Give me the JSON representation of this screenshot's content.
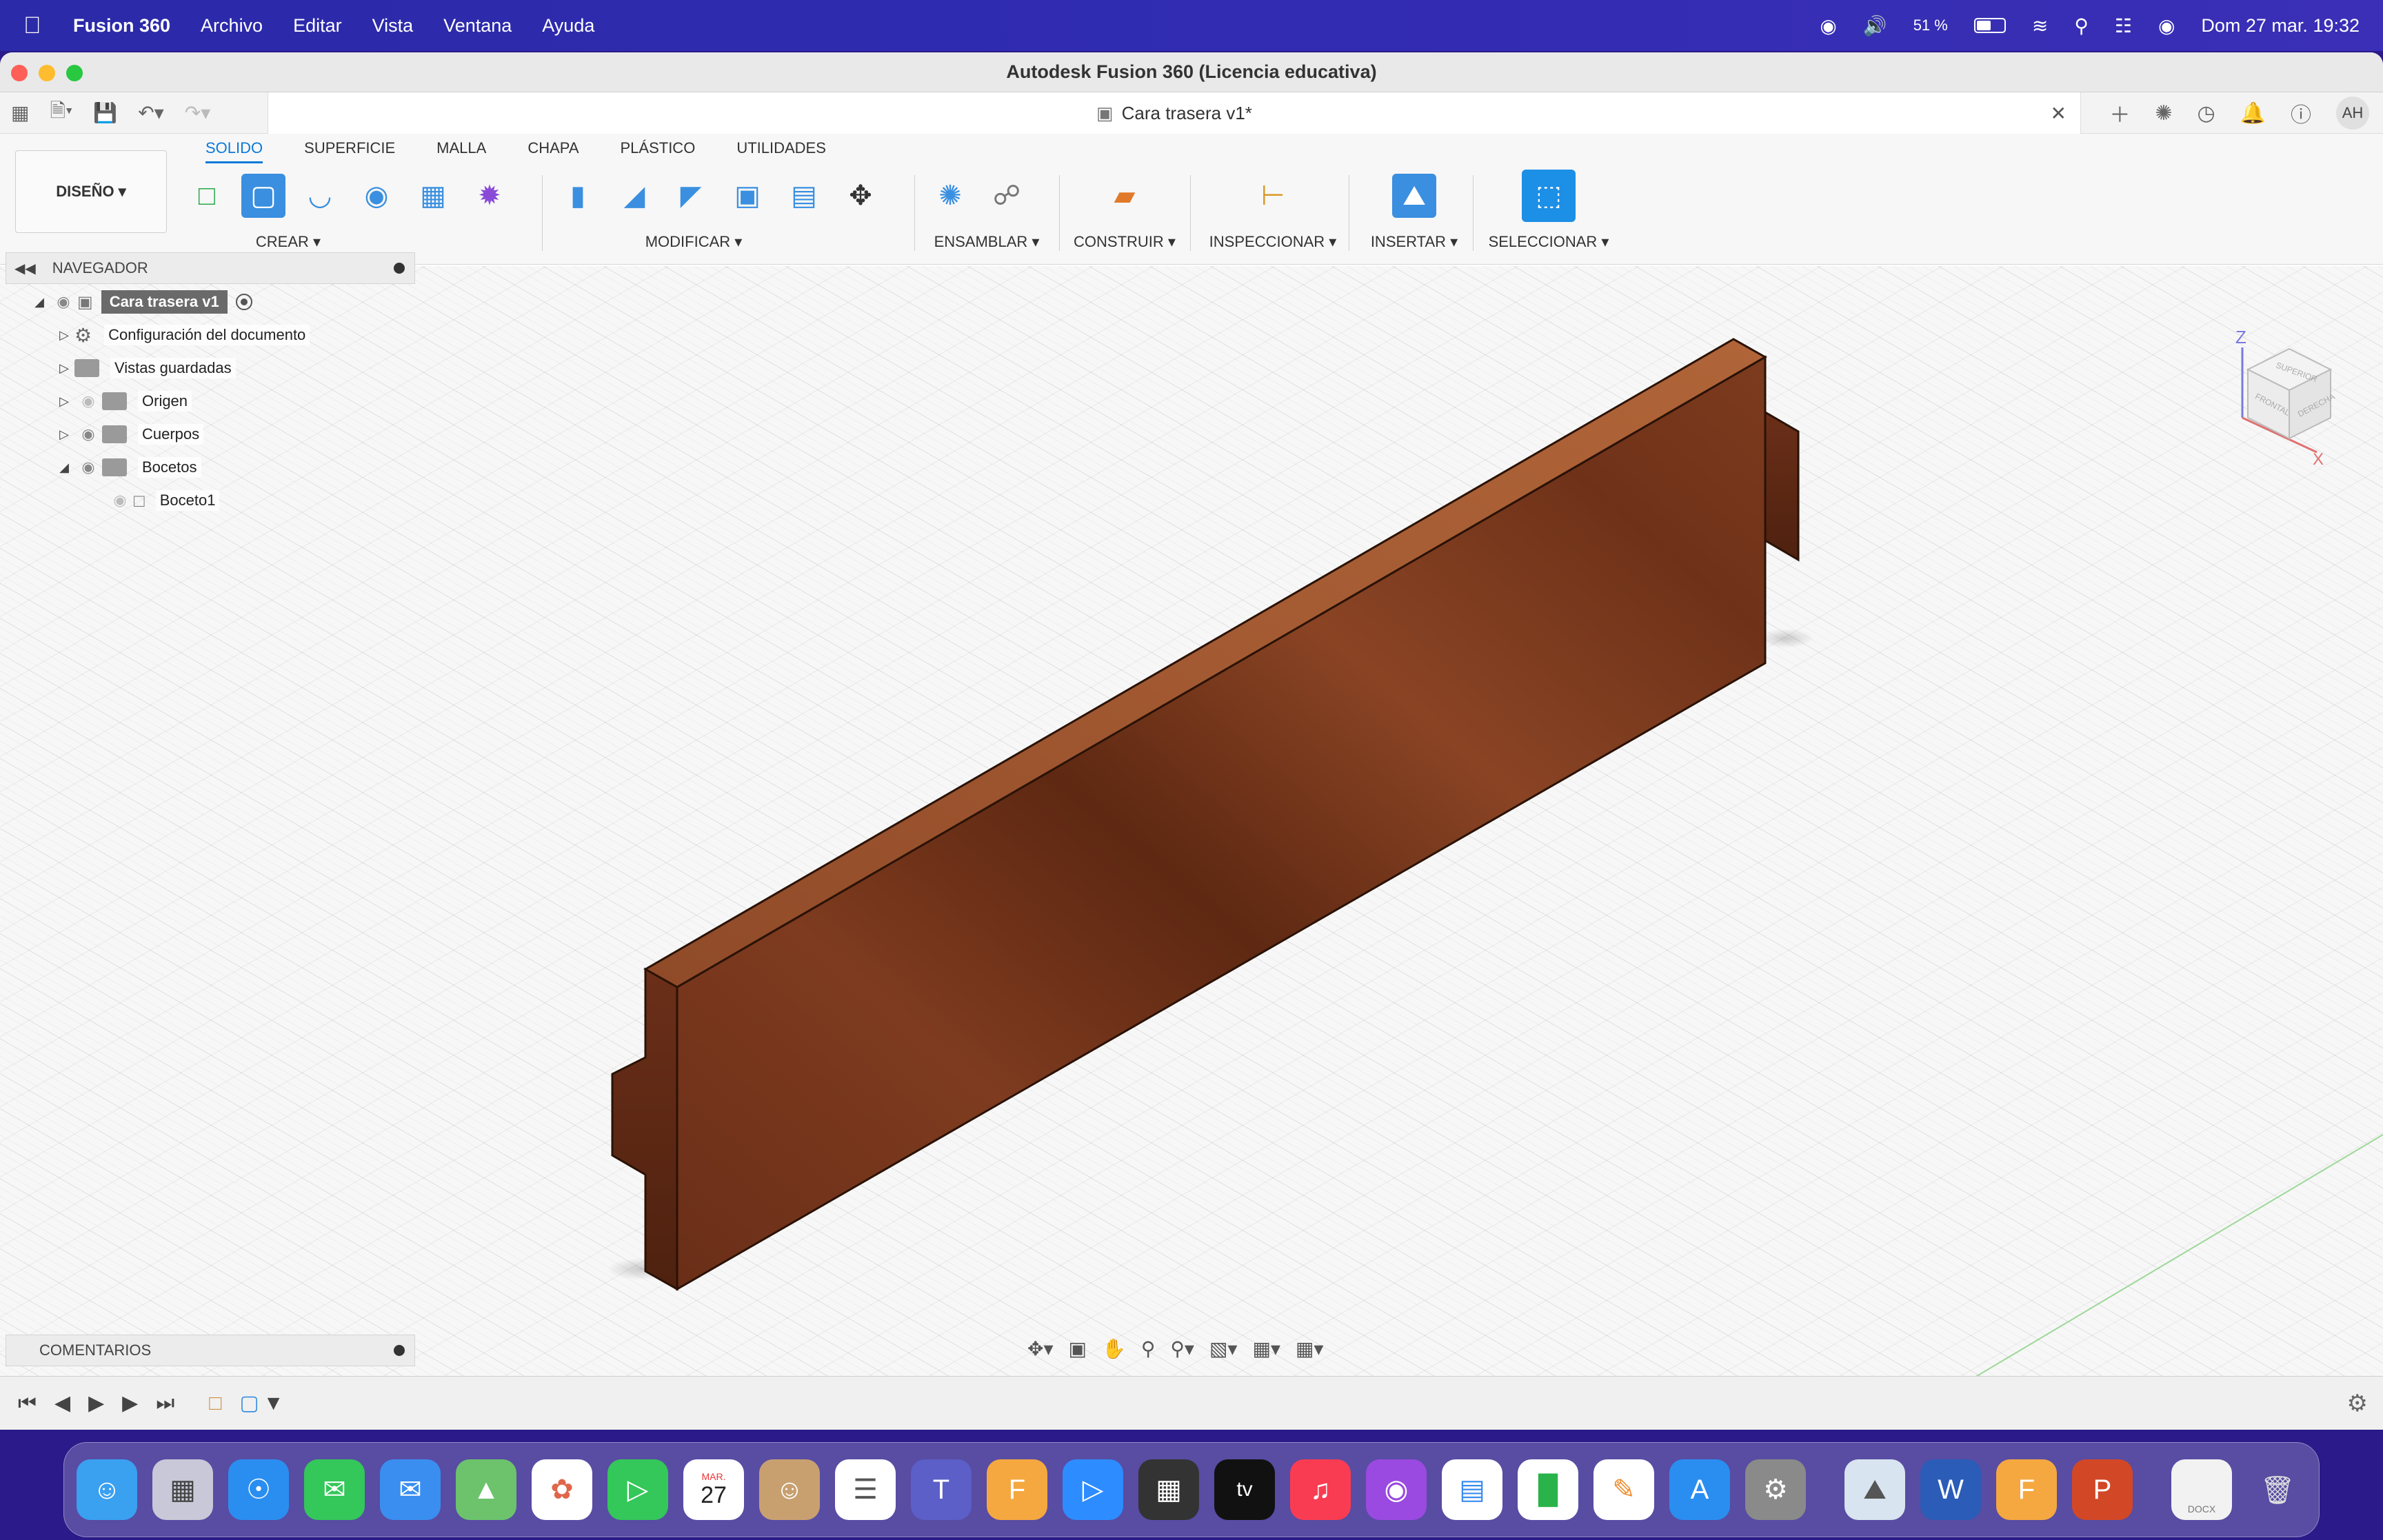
{
  "menubar": {
    "app_name": "Fusion 360",
    "items": [
      "Archivo",
      "Editar",
      "Vista",
      "Ventana",
      "Ayuda"
    ],
    "battery": "51 %",
    "datetime": "Dom 27 mar.  19:32"
  },
  "window": {
    "title": "Autodesk Fusion 360 (Licencia educativa)",
    "doc_tab": "Cara trasera v1*",
    "user_initials": "AH"
  },
  "ribbon": {
    "workspace": "DISEÑO ▾",
    "tabs": [
      "SOLIDO",
      "SUPERFICIE",
      "MALLA",
      "CHAPA",
      "PLÁSTICO",
      "UTILIDADES"
    ],
    "groups": {
      "crear": "CREAR ▾",
      "modificar": "MODIFICAR ▾",
      "ensamblar": "ENSAMBLAR ▾",
      "construir": "CONSTRUIR ▾",
      "inspeccionar": "INSPECCIONAR ▾",
      "insertar": "INSERTAR ▾",
      "seleccionar": "SELECCIONAR ▾"
    }
  },
  "navigator": {
    "title": "NAVEGADOR",
    "root": "Cara trasera v1",
    "nodes": [
      "Configuración del documento",
      "Vistas guardadas",
      "Origen",
      "Cuerpos",
      "Bocetos"
    ],
    "sketch": "Boceto1"
  },
  "comments": {
    "title": "COMENTARIOS"
  },
  "viewcube": {
    "z": "Z",
    "x": "X",
    "top": "SUPERIOR",
    "front": "FRONTAL",
    "right": "DERECHA"
  },
  "dock": {
    "calendar_month": "MAR.",
    "calendar_day": "27",
    "docx_label": "DOCX",
    "tv_label": "tv"
  },
  "colors": {
    "accent": "#0a7ad8",
    "wood_dark": "#5e2a16",
    "wood_mid": "#7a3a1f",
    "wood_light": "#a05a34"
  }
}
